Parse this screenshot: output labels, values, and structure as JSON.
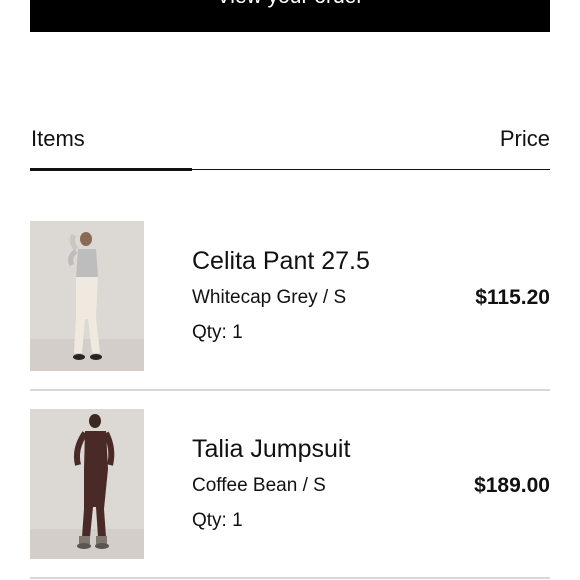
{
  "cta": {
    "label": "View your order"
  },
  "table": {
    "items_header": "Items",
    "price_header": "Price"
  },
  "items": [
    {
      "name": "Celita Pant 27.5",
      "variant": "Whitecap Grey / S",
      "qty": "Qty: 1",
      "price": "$115.20"
    },
    {
      "name": "Talia Jumpsuit",
      "variant": "Coffee Bean / S",
      "qty": "Qty: 1",
      "price": "$189.00"
    }
  ],
  "colors": {
    "accent": "#000000",
    "divider": "#d8d8d8",
    "thumb_bg": "#dcd8d4"
  }
}
